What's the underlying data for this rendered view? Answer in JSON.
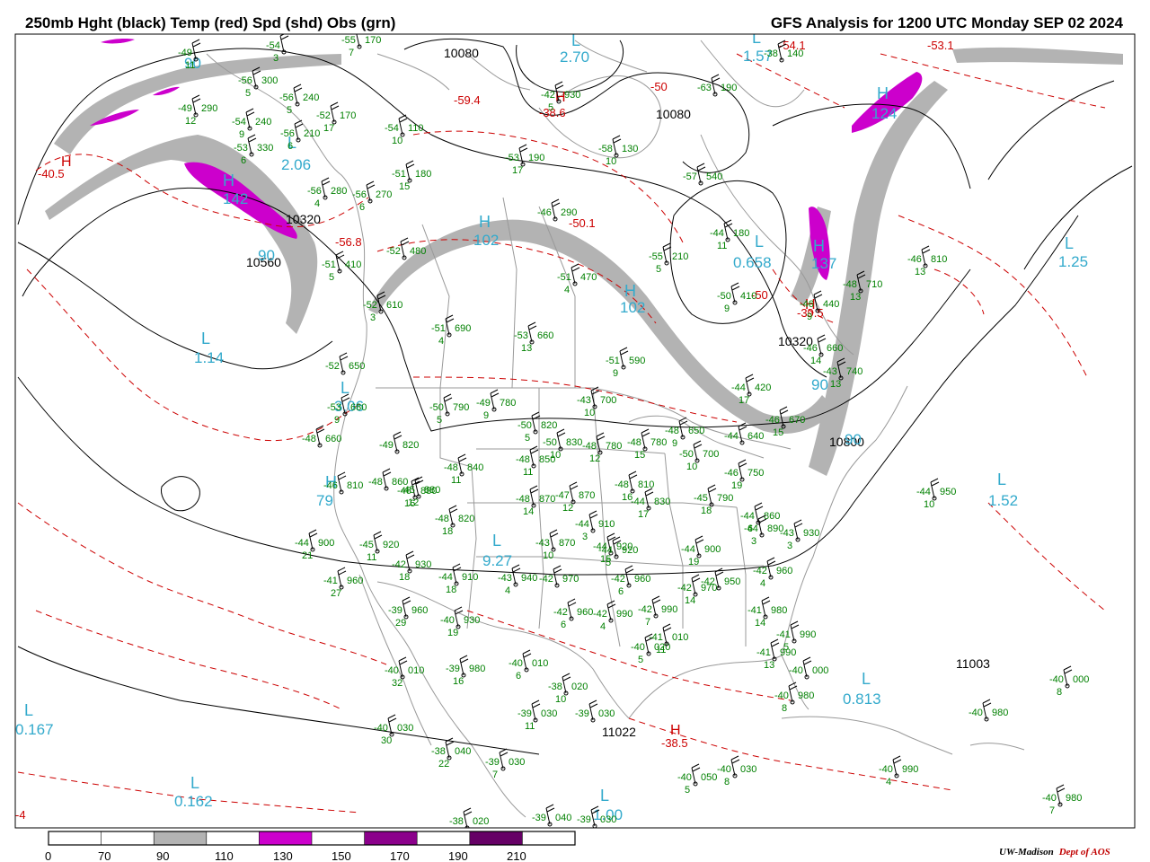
{
  "header": {
    "left": "250mb Hght (black) Temp (red) Spd (shd) Obs (grn)",
    "right": "GFS Analysis for 1200 UTC Monday SEP 02 2024"
  },
  "legend": {
    "ticks": [
      "0",
      "70",
      "90",
      "110",
      "130",
      "150",
      "170",
      "190",
      "210"
    ],
    "segments": [
      {
        "color": "#ffffff"
      },
      {
        "color": "#ffffff"
      },
      {
        "color": "#b3b3b3"
      },
      {
        "color": "#ffffff"
      },
      {
        "color": "#cc00cc"
      },
      {
        "color": "#ffffff"
      },
      {
        "color": "#8b008b"
      },
      {
        "color": "#ffffff"
      },
      {
        "color": "#660066"
      },
      {
        "color": "#ffffff"
      }
    ]
  },
  "credit": {
    "institution": "UW-Madison",
    "department": "Dept of AOS"
  },
  "colors": {
    "height": "#000000",
    "temp": "#cc0000",
    "speed_label": "#33aacc",
    "obs": "#008000",
    "borders": "#999999"
  },
  "height_labels": [
    {
      "t": "10080"
    },
    {
      "t": "10080"
    },
    {
      "t": "10320"
    },
    {
      "t": "10560"
    },
    {
      "t": "10320"
    },
    {
      "t": "10800"
    },
    {
      "t": "11003"
    },
    {
      "t": "11022"
    }
  ],
  "speed_labels": [
    {
      "t": "L"
    },
    {
      "t": "2.70"
    },
    {
      "t": "90"
    },
    {
      "t": "L"
    },
    {
      "t": "1.57"
    },
    {
      "t": "L"
    },
    {
      "t": "2.06"
    },
    {
      "t": "H"
    },
    {
      "t": "142"
    },
    {
      "t": "H"
    },
    {
      "t": "124"
    },
    {
      "t": "H"
    },
    {
      "t": "102"
    },
    {
      "t": "L"
    },
    {
      "t": "0.658"
    },
    {
      "t": "H"
    },
    {
      "t": "137"
    },
    {
      "t": "L"
    },
    {
      "t": "1.25"
    },
    {
      "t": "H"
    },
    {
      "t": "102"
    },
    {
      "t": "L"
    },
    {
      "t": "1.14"
    },
    {
      "t": "L"
    },
    {
      "t": "3.06"
    },
    {
      "t": "90"
    },
    {
      "t": "90"
    },
    {
      "t": "H"
    },
    {
      "t": "79"
    },
    {
      "t": "L"
    },
    {
      "t": "9.27"
    },
    {
      "t": "L"
    },
    {
      "t": "1.52"
    },
    {
      "t": "L"
    },
    {
      "t": "0.813"
    },
    {
      "t": "L"
    },
    {
      "t": "0.167"
    },
    {
      "t": "L"
    },
    {
      "t": "0.162"
    },
    {
      "t": "L"
    },
    {
      "t": "1.00"
    },
    {
      "t": "90"
    }
  ],
  "temp_labels": [
    {
      "t": "-59.4"
    },
    {
      "t": "H"
    },
    {
      "t": "-40.5"
    },
    {
      "t": "H"
    },
    {
      "t": "-38.6"
    },
    {
      "t": "-50"
    },
    {
      "t": "-56.8"
    },
    {
      "t": "-54.1"
    },
    {
      "t": "-53.1"
    },
    {
      "t": "H"
    },
    {
      "t": "-39.5"
    },
    {
      "t": "-50.1"
    },
    {
      "t": "H"
    },
    {
      "t": "-38.5"
    },
    {
      "t": "-50"
    },
    {
      "t": "-4"
    }
  ],
  "obs": [
    {
      "t": "-49",
      "h": "",
      "s": "11"
    },
    {
      "t": "-54",
      "h": "",
      "s": "3"
    },
    {
      "t": "-55",
      "h": "170",
      "s": "7"
    },
    {
      "t": "-56",
      "h": "300",
      "s": "5"
    },
    {
      "t": "-56",
      "h": "240",
      "s": "5"
    },
    {
      "t": "-49",
      "h": "290",
      "s": "12"
    },
    {
      "t": "-52",
      "h": "170",
      "s": "17"
    },
    {
      "t": "-54",
      "h": "240",
      "s": "9"
    },
    {
      "t": "-54",
      "h": "110",
      "s": "10"
    },
    {
      "t": "-53",
      "h": "330",
      "s": "6"
    },
    {
      "t": "-56",
      "h": "210",
      "s": "6"
    },
    {
      "t": "-42",
      "h": "930",
      "s": "5"
    },
    {
      "t": "-38",
      "h": "140",
      "s": ""
    },
    {
      "t": "-63",
      "h": "190",
      "s": ""
    },
    {
      "t": "-53",
      "h": "190",
      "s": "17"
    },
    {
      "t": "-58",
      "h": "130",
      "s": "10"
    },
    {
      "t": "-51",
      "h": "180",
      "s": "15"
    },
    {
      "t": "-57",
      "h": "540",
      "s": ""
    },
    {
      "t": "-56",
      "h": "280",
      "s": "4"
    },
    {
      "t": "-56",
      "h": "270",
      "s": "6"
    },
    {
      "t": "-46",
      "h": "290",
      "s": ""
    },
    {
      "t": "-44",
      "h": "180",
      "s": "11"
    },
    {
      "t": "-55",
      "h": "210",
      "s": "5"
    },
    {
      "t": "-52",
      "h": "480",
      "s": ""
    },
    {
      "t": "-51",
      "h": "410",
      "s": "5"
    },
    {
      "t": "-51",
      "h": "470",
      "s": "4"
    },
    {
      "t": "-52",
      "h": "610",
      "s": "3"
    },
    {
      "t": "-51",
      "h": "690",
      "s": "4"
    },
    {
      "t": "-53",
      "h": "660",
      "s": "13"
    },
    {
      "t": "-51",
      "h": "590",
      "s": "9"
    },
    {
      "t": "-52",
      "h": "650",
      "s": ""
    },
    {
      "t": "-50",
      "h": "790",
      "s": "5"
    },
    {
      "t": "-49",
      "h": "780",
      "s": "9"
    },
    {
      "t": "-43",
      "h": "700",
      "s": "10"
    },
    {
      "t": "-53",
      "h": "680",
      "s": "9"
    },
    {
      "t": "-48",
      "h": "660",
      "s": ""
    },
    {
      "t": "-49",
      "h": "820",
      "s": ""
    },
    {
      "t": "-50",
      "h": "820",
      "s": "5"
    },
    {
      "t": "-50",
      "h": "830",
      "s": "10"
    },
    {
      "t": "-48",
      "h": "780",
      "s": "12"
    },
    {
      "t": "-48",
      "h": "780",
      "s": "15"
    },
    {
      "t": "-48",
      "h": "650",
      "s": "9"
    },
    {
      "t": "-50",
      "h": "700",
      "s": "10"
    },
    {
      "t": "-44",
      "h": "420",
      "s": "17"
    },
    {
      "t": "-46",
      "h": "660",
      "s": "14"
    },
    {
      "t": "-46",
      "h": "670",
      "s": "15"
    },
    {
      "t": "-44",
      "h": "640",
      "s": ""
    },
    {
      "t": "-46",
      "h": "810",
      "s": "13"
    },
    {
      "t": "-48",
      "h": "710",
      "s": "13"
    },
    {
      "t": "-43",
      "h": "740",
      "s": "13"
    },
    {
      "t": "-46",
      "h": "440",
      "s": "9"
    },
    {
      "t": "-50",
      "h": "410",
      "s": "9"
    },
    {
      "t": "-48",
      "h": "840",
      "s": "11"
    },
    {
      "t": "-48",
      "h": "850",
      "s": "11"
    },
    {
      "t": "-48",
      "h": "870",
      "s": "14"
    },
    {
      "t": "-47",
      "h": "870",
      "s": "12"
    },
    {
      "t": "-48",
      "h": "810",
      "s": "16"
    },
    {
      "t": "-44",
      "h": "830",
      "s": "17"
    },
    {
      "t": "-45",
      "h": "790",
      "s": "18"
    },
    {
      "t": "-46",
      "h": "750",
      "s": "19"
    },
    {
      "t": "-43",
      "h": "870",
      "s": "10"
    },
    {
      "t": "-46",
      "h": "880",
      "s": "16"
    },
    {
      "t": "-48",
      "h": "860",
      "s": ""
    },
    {
      "t": "-45",
      "h": "880",
      "s": "12"
    },
    {
      "t": "-46",
      "h": "810",
      "s": ""
    },
    {
      "t": "-48",
      "h": "820",
      "s": "18"
    },
    {
      "t": "-44",
      "h": "900",
      "s": "21"
    },
    {
      "t": "-45",
      "h": "920",
      "s": "11"
    },
    {
      "t": "-42",
      "h": "930",
      "s": "18"
    },
    {
      "t": "-44",
      "h": "920",
      "s": "15"
    },
    {
      "t": "-44",
      "h": "910",
      "s": "3"
    },
    {
      "t": "-44",
      "h": "920",
      "s": "5"
    },
    {
      "t": "-44",
      "h": "900",
      "s": "19"
    },
    {
      "t": "-44",
      "h": "860",
      "s": "6"
    },
    {
      "t": "-44",
      "h": "890",
      "s": "3"
    },
    {
      "t": "-43",
      "h": "930",
      "s": "3"
    },
    {
      "t": "-41",
      "h": "960",
      "s": "27"
    },
    {
      "t": "-44",
      "h": "910",
      "s": "18"
    },
    {
      "t": "-43",
      "h": "940",
      "s": "4"
    },
    {
      "t": "-42",
      "h": "970",
      "s": ""
    },
    {
      "t": "-42",
      "h": "960",
      "s": "6"
    },
    {
      "t": "-42",
      "h": "970",
      "s": "14"
    },
    {
      "t": "-42",
      "h": "950",
      "s": ""
    },
    {
      "t": "-42",
      "h": "960",
      "s": "4"
    },
    {
      "t": "-39",
      "h": "960",
      "s": "29"
    },
    {
      "t": "-40",
      "h": "930",
      "s": "19"
    },
    {
      "t": "-42",
      "h": "960",
      "s": "6"
    },
    {
      "t": "-42",
      "h": "990",
      "s": "4"
    },
    {
      "t": "-42",
      "h": "990",
      "s": "7"
    },
    {
      "t": "-41",
      "h": "980",
      "s": "14"
    },
    {
      "t": "-41",
      "h": "990",
      "s": "5"
    },
    {
      "t": "-40",
      "h": "020",
      "s": "5"
    },
    {
      "t": "-41",
      "h": "010",
      "s": "11"
    },
    {
      "t": "-41",
      "h": "990",
      "s": "13"
    },
    {
      "t": "-40",
      "h": "000",
      "s": ""
    },
    {
      "t": "-40",
      "h": "980",
      "s": "8"
    },
    {
      "t": "-40",
      "h": "010",
      "s": "32"
    },
    {
      "t": "-39",
      "h": "980",
      "s": "16"
    },
    {
      "t": "-40",
      "h": "010",
      "s": "6"
    },
    {
      "t": "-38",
      "h": "020",
      "s": "10"
    },
    {
      "t": "-39",
      "h": "030",
      "s": "11"
    },
    {
      "t": "-39",
      "h": "030",
      "s": ""
    },
    {
      "t": "-40",
      "h": "030",
      "s": "30"
    },
    {
      "t": "-38",
      "h": "040",
      "s": "22"
    },
    {
      "t": "-39",
      "h": "030",
      "s": "7"
    },
    {
      "t": "-40",
      "h": "050",
      "s": "5"
    },
    {
      "t": "-40",
      "h": "030",
      "s": "8"
    },
    {
      "t": "-40",
      "h": "000",
      "s": "8"
    },
    {
      "t": "-40",
      "h": "980",
      "s": ""
    },
    {
      "t": "-40",
      "h": "990",
      "s": "4"
    },
    {
      "t": "-40",
      "h": "980",
      "s": "7"
    },
    {
      "t": "-44",
      "h": "950",
      "s": "10"
    },
    {
      "t": "-38",
      "h": "020",
      "s": ""
    },
    {
      "t": "-39",
      "h": "040",
      "s": ""
    },
    {
      "t": "-39",
      "h": "030",
      "s": ""
    }
  ]
}
